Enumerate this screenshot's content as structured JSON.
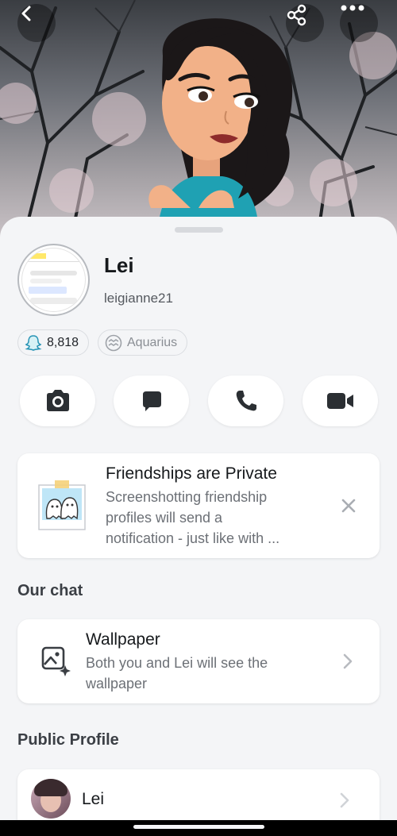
{
  "header": {
    "back_icon": "chevron-left-icon",
    "share_icon": "share-icon",
    "more_icon": "more-horizontal-icon"
  },
  "profile": {
    "display_name": "Lei",
    "username": "leigianne21",
    "snap_score": "8,818",
    "zodiac": "Aquarius"
  },
  "actions": [
    {
      "name": "camera",
      "icon": "camera-icon"
    },
    {
      "name": "chat",
      "icon": "chat-bubble-icon"
    },
    {
      "name": "call",
      "icon": "phone-icon"
    },
    {
      "name": "video",
      "icon": "video-camera-icon"
    }
  ],
  "privacy_card": {
    "title": "Friendships are Private",
    "line1": "Screenshotting friendship",
    "line2": "profiles will send a",
    "line3": "notification - just like with ..."
  },
  "our_chat": {
    "heading": "Our chat",
    "wallpaper_title": "Wallpaper",
    "wallpaper_line1": "Both you and Lei will see the",
    "wallpaper_line2": "wallpaper"
  },
  "public_profile": {
    "heading": "Public Profile",
    "name": "Lei"
  },
  "colors": {
    "sheet_bg": "#f4f5f7",
    "card_bg": "#ffffff",
    "text_primary": "#16191c",
    "text_secondary": "#6c7076"
  }
}
